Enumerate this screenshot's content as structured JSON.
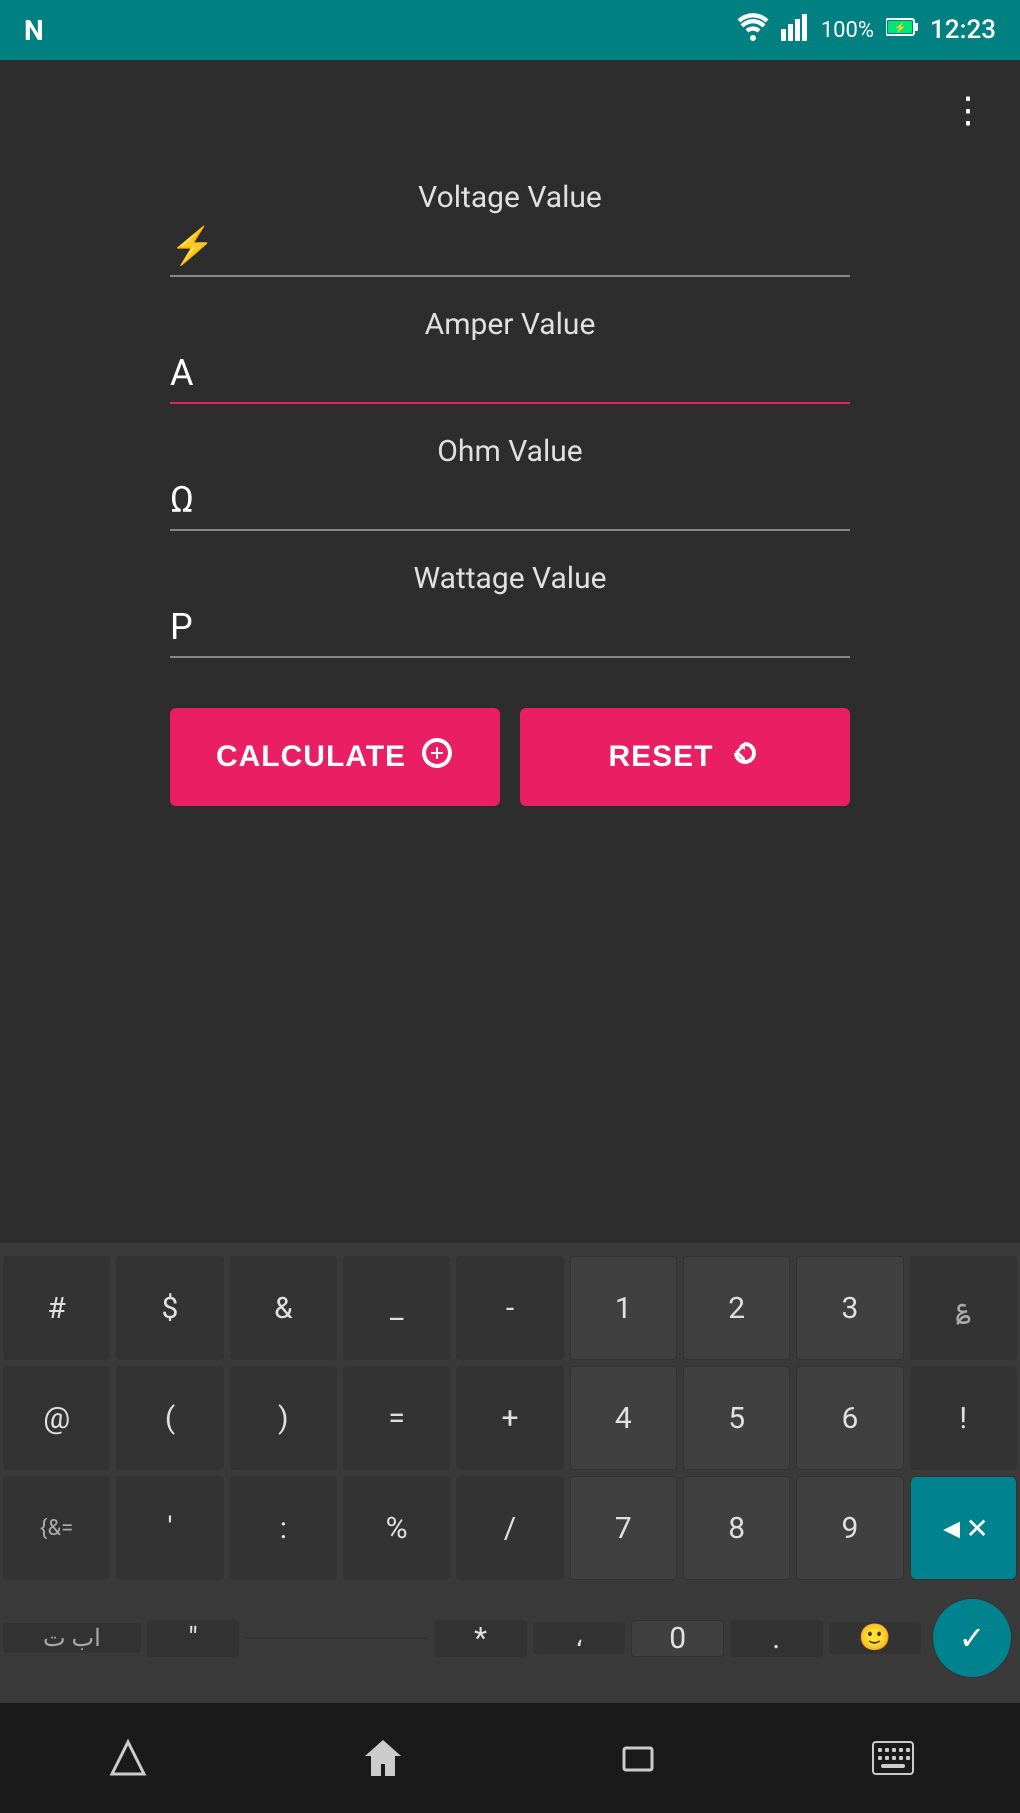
{
  "statusBar": {
    "logo": "N",
    "wifi": "wifi",
    "signal": "signal",
    "battery": "100%",
    "time": "12:23"
  },
  "appBar": {
    "menuIcon": "⋮"
  },
  "fields": {
    "voltage": {
      "label": "Voltage Value",
      "icon": "⚡",
      "value": "",
      "placeholder": ""
    },
    "amper": {
      "label": "Amper Value",
      "icon": "A",
      "value": "",
      "placeholder": "",
      "active": true
    },
    "ohm": {
      "label": "Ohm Value",
      "icon": "Ω",
      "value": "",
      "placeholder": ""
    },
    "wattage": {
      "label": "Wattage Value",
      "icon": "P",
      "value": "",
      "placeholder": ""
    }
  },
  "buttons": {
    "calculate": "CALCULATE",
    "reset": "RESET"
  },
  "keyboard": {
    "row1": [
      "#",
      "$",
      "&",
      "_",
      "-",
      "1",
      "2",
      "3",
      "?"
    ],
    "row2": [
      "@",
      "(",
      ")",
      "=",
      "+",
      "4",
      "5",
      "6",
      "!"
    ],
    "row3": [
      "{&=",
      "'",
      ":",
      "%",
      "/",
      "7",
      "8",
      "9",
      "⌫"
    ],
    "row4_left": [
      "اب ت",
      "\"",
      "",
      "*",
      "،",
      "0",
      ".",
      ""
    ],
    "languageKey": "اب ت",
    "checkKey": "✓"
  },
  "bottomNav": {
    "back": "▽",
    "home": "⌂",
    "recents": "▭",
    "keyboard": "⌨"
  }
}
